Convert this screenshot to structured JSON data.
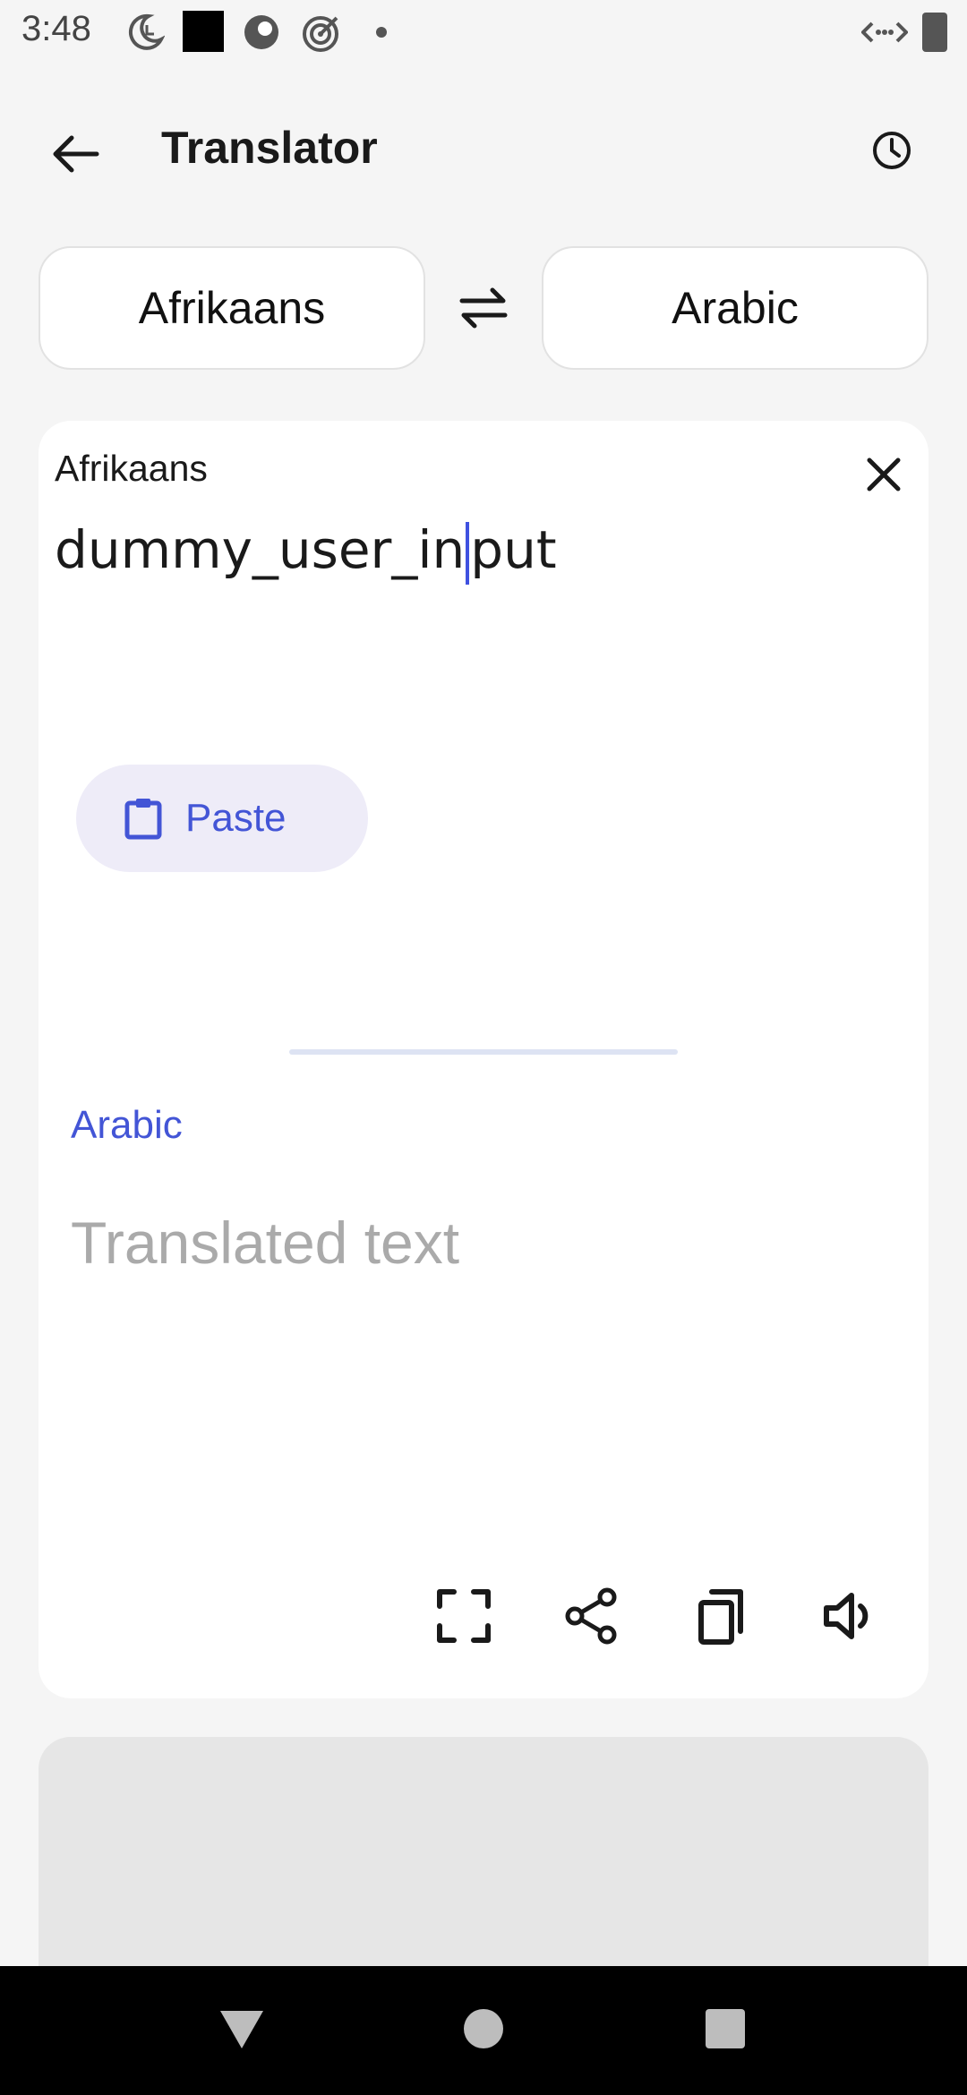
{
  "status_bar": {
    "time": "3:48",
    "icons_left": [
      "moon-clock-icon",
      "black-square-icon",
      "record-icon",
      "target-icon",
      "dot-icon"
    ],
    "icons_right": [
      "data-arrows-icon",
      "battery-icon"
    ]
  },
  "header": {
    "title": "Translator",
    "back_icon": "back-arrow-icon",
    "history_icon": "history-icon"
  },
  "languages": {
    "source": "Afrikaans",
    "target": "Arabic",
    "swap_icon": "swap-arrows-icon"
  },
  "input": {
    "label": "Afrikaans",
    "text_before_cursor": "dummy_user_in",
    "text_after_cursor": "put",
    "clear_icon": "close-icon",
    "paste_label": "Paste",
    "paste_icon": "clipboard-icon"
  },
  "output": {
    "label": "Arabic",
    "placeholder": "Translated text",
    "actions": [
      "fullscreen-icon",
      "share-icon",
      "copy-icon",
      "speaker-icon"
    ]
  },
  "colors": {
    "accent": "#4355d6",
    "background": "#f5f5f5",
    "card": "#ffffff",
    "placeholder": "#aaaaaa"
  }
}
